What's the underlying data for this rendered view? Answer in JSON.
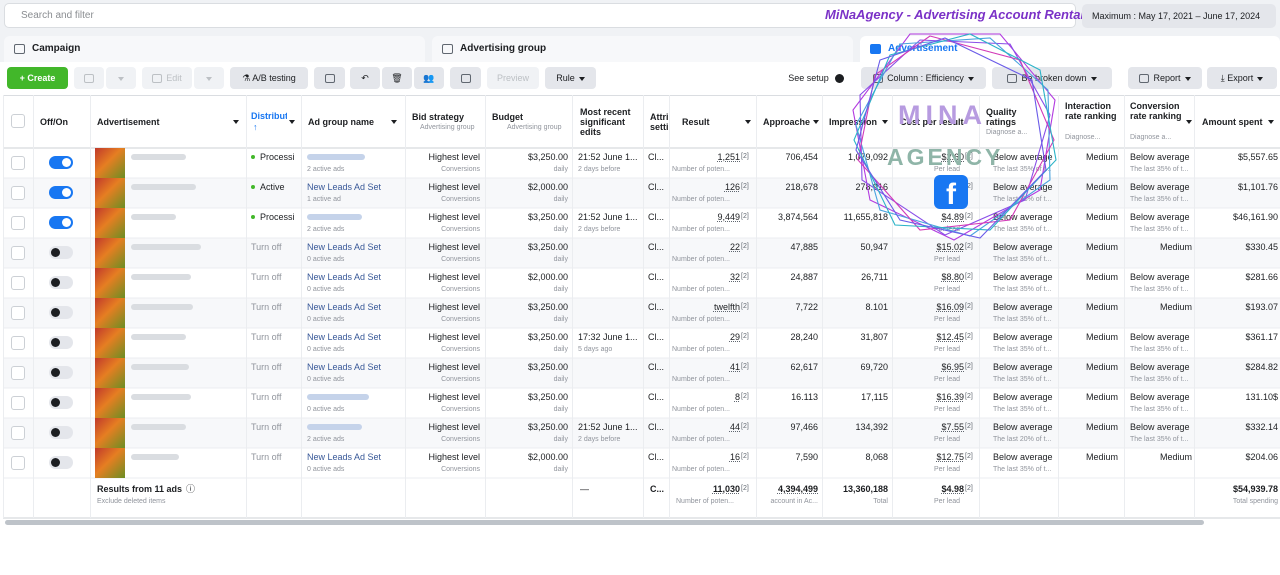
{
  "topbar": {
    "search_placeholder": "Search and filter",
    "brand": "MiNaAgency - Advertising Account Rental",
    "date_range": "Maximum : May 17, 2021 – June 17, 2024"
  },
  "tabs": [
    {
      "label": "Campaign",
      "icon": "folder-icon"
    },
    {
      "label": "Advertising group",
      "icon": "grid-icon"
    },
    {
      "label": "Advertisement",
      "icon": "ad-icon",
      "active": true
    }
  ],
  "toolbar": {
    "create": "Create",
    "edit": "Edit",
    "ab_testing": "A/B testing",
    "preview": "Preview",
    "rule": "Rule",
    "see_setup": "See setup",
    "column": "Column : Efficiency",
    "broken_down": "Be broken down",
    "report": "Report",
    "export": "Export"
  },
  "columns": {
    "off_on": "Off/On",
    "advertisement": "Advertisement",
    "distribution": "Distribution",
    "sort_arrow": "↑",
    "ad_group_name": "Ad group name",
    "bid_strategy": "Bid strategy",
    "bid_strategy_sub": "Advertising group",
    "budget": "Budget",
    "budget_sub": "Advertising group",
    "most_recent": "Most recent significant edits",
    "attribution": "Attribution settings",
    "result": "Result",
    "approach": "Approache",
    "impression": "Impression",
    "cost": "Cost per result",
    "quality": "Quality ratings",
    "quality_sub": "Diagnose a...",
    "interaction": "Interaction rate ranking",
    "interaction_sub": "Diagnose...",
    "conversion": "Conversion rate ranking",
    "conversion_sub": "Diagnose a...",
    "amount": "Amount spent"
  },
  "rows": [
    {
      "on": true,
      "status": "Processi",
      "status_dot": true,
      "group": "",
      "group_sub": "2 active ads",
      "bid": "Highest level",
      "bid_sub": "Conversions",
      "budget": "$3,250.00",
      "budget_sub": "daily",
      "edit": "21:52 June 1...",
      "edit_sub": "2 days before",
      "attr": "Cl...",
      "result": "1,251",
      "result_note": "[2]",
      "result_sub": "Number of poten...",
      "reach": "706,454",
      "impr": "1,079,092",
      "cost": "$2.60",
      "cost_note": "[2]",
      "cost_sub": "Per lead",
      "quality": "Below average",
      "quality_sub": "The last 35% of t...",
      "interaction": "Medium",
      "conversion": "Below average",
      "conversion_sub": "The last 35% of t...",
      "amount": "$5,557.65"
    },
    {
      "on": true,
      "status": "Active",
      "status_dot": true,
      "group": "New Leads Ad Set",
      "group_sub": "1 active ad",
      "bid": "Highest level",
      "bid_sub": "Conversions",
      "budget": "$2,000.00",
      "budget_sub": "daily",
      "edit": "",
      "edit_sub": "",
      "attr": "Cl...",
      "result": "126",
      "result_note": "[2]",
      "result_sub": "Number of poten...",
      "reach": "218,678",
      "impr": "278,916",
      "cost": "$8.74",
      "cost_note": "[2]",
      "cost_sub": "Per lead",
      "quality": "Below average",
      "quality_sub": "The last 35% of t...",
      "interaction": "Medium",
      "conversion": "Below average",
      "conversion_sub": "The last 35% of t...",
      "amount": "$1,101.76"
    },
    {
      "on": true,
      "status": "Processi",
      "status_dot": true,
      "group": "",
      "group_sub": "2 active ads",
      "bid": "Highest level",
      "bid_sub": "Conversions",
      "budget": "$3,250.00",
      "budget_sub": "daily",
      "edit": "21:52 June 1...",
      "edit_sub": "2 days before",
      "attr": "Cl...",
      "result": "9,449",
      "result_note": "[2]",
      "result_sub": "Number of poten...",
      "reach": "3,874,564",
      "impr": "11,655,818",
      "cost": "$4.89",
      "cost_note": "[2]",
      "cost_sub": "Per lead",
      "quality": "Below average",
      "quality_sub": "The last 35% of t...",
      "interaction": "Medium",
      "conversion": "Below average",
      "conversion_sub": "The last 35% of t...",
      "amount": "$46,161.90"
    },
    {
      "on": false,
      "status": "Turn off",
      "status_dot": false,
      "group": "New Leads Ad Set",
      "group_sub": "0 active ads",
      "bid": "Highest level",
      "bid_sub": "Conversions",
      "budget": "$3,250.00",
      "budget_sub": "daily",
      "edit": "",
      "edit_sub": "",
      "attr": "Cl...",
      "result": "22",
      "result_note": "[2]",
      "result_sub": "Number of poten...",
      "reach": "47,885",
      "impr": "50,947",
      "cost": "$15.02",
      "cost_note": "[2]",
      "cost_sub": "Per lead",
      "quality": "Below average",
      "quality_sub": "The last 35% of t...",
      "interaction": "Medium",
      "conversion": "Medium",
      "conversion_sub": "",
      "amount": "$330.45"
    },
    {
      "on": false,
      "status": "Turn off",
      "status_dot": false,
      "group": "New Leads Ad Set",
      "group_sub": "0 active ads",
      "bid": "Highest level",
      "bid_sub": "Conversions",
      "budget": "$2,000.00",
      "budget_sub": "daily",
      "edit": "",
      "edit_sub": "",
      "attr": "Cl...",
      "result": "32",
      "result_note": "[2]",
      "result_sub": "Number of poten...",
      "reach": "24,887",
      "impr": "26,711",
      "cost": "$8.80",
      "cost_note": "[2]",
      "cost_sub": "Per lead",
      "quality": "Below average",
      "quality_sub": "The last 35% of t...",
      "interaction": "Medium",
      "conversion": "Below average",
      "conversion_sub": "The last 35% of t...",
      "amount": "$281.66"
    },
    {
      "on": false,
      "status": "Turn off",
      "status_dot": false,
      "group": "New Leads Ad Set",
      "group_sub": "0 active ads",
      "bid": "Highest level",
      "bid_sub": "Conversions",
      "budget": "$3,250.00",
      "budget_sub": "daily",
      "edit": "",
      "edit_sub": "",
      "attr": "Cl...",
      "result": "twelfth",
      "result_note": "[2]",
      "result_sub": "Number of poten...",
      "reach": "7,722",
      "impr": "8.101",
      "cost": "$16.09",
      "cost_note": "[2]",
      "cost_sub": "Per lead",
      "quality": "Below average",
      "quality_sub": "The last 35% of t...",
      "interaction": "Medium",
      "conversion": "Medium",
      "conversion_sub": "",
      "amount": "$193.07"
    },
    {
      "on": false,
      "status": "Turn off",
      "status_dot": false,
      "group": "New Leads Ad Set",
      "group_sub": "0 active ads",
      "bid": "Highest level",
      "bid_sub": "Conversions",
      "budget": "$3,250.00",
      "budget_sub": "daily",
      "edit": "17:32 June 1...",
      "edit_sub": "5 days ago",
      "attr": "Cl...",
      "result": "29",
      "result_note": "[2]",
      "result_sub": "Number of poten...",
      "reach": "28,240",
      "impr": "31,807",
      "cost": "$12.45",
      "cost_note": "[2]",
      "cost_sub": "Per lead",
      "quality": "Below average",
      "quality_sub": "The last 35% of t...",
      "interaction": "Medium",
      "conversion": "Below average",
      "conversion_sub": "The last 35% of t...",
      "amount": "$361.17"
    },
    {
      "on": false,
      "status": "Turn off",
      "status_dot": false,
      "group": "New Leads Ad Set",
      "group_sub": "0 active ads",
      "bid": "Highest level",
      "bid_sub": "Conversions",
      "budget": "$3,250.00",
      "budget_sub": "daily",
      "edit": "",
      "edit_sub": "",
      "attr": "Cl...",
      "result": "41",
      "result_note": "[2]",
      "result_sub": "Number of poten...",
      "reach": "62,617",
      "impr": "69,720",
      "cost": "$6.95",
      "cost_note": "[2]",
      "cost_sub": "Per lead",
      "quality": "Below average",
      "quality_sub": "The last 35% of t...",
      "interaction": "Medium",
      "conversion": "Below average",
      "conversion_sub": "The last 35% of t...",
      "amount": "$284.82"
    },
    {
      "on": false,
      "status": "Turn off",
      "status_dot": false,
      "group": "",
      "group_sub": "0 active ads",
      "bid": "Highest level",
      "bid_sub": "Conversions",
      "budget": "$3,250.00",
      "budget_sub": "daily",
      "edit": "",
      "edit_sub": "",
      "attr": "Cl...",
      "result": "8",
      "result_note": "[2]",
      "result_sub": "Number of poten...",
      "reach": "16.113",
      "impr": "17,115",
      "cost": "$16.39",
      "cost_note": "[2]",
      "cost_sub": "Per lead",
      "quality": "Below average",
      "quality_sub": "The last 35% of t...",
      "interaction": "Medium",
      "conversion": "Below average",
      "conversion_sub": "The last 35% of t...",
      "amount": "131.10$"
    },
    {
      "on": false,
      "status": "Turn off",
      "status_dot": false,
      "group": "",
      "group_sub": "2 active ads",
      "bid": "Highest level",
      "bid_sub": "Conversions",
      "budget": "$3,250.00",
      "budget_sub": "daily",
      "edit": "21:52 June 1...",
      "edit_sub": "2 days before",
      "attr": "Cl...",
      "result": "44",
      "result_note": "[2]",
      "result_sub": "Number of poten...",
      "reach": "97,466",
      "impr": "134,392",
      "cost": "$7.55",
      "cost_note": "[2]",
      "cost_sub": "Per lead",
      "quality": "Below average",
      "quality_sub": "The last 20% of t...",
      "interaction": "Medium",
      "conversion": "Below average",
      "conversion_sub": "The last 35% of t...",
      "amount": "$332.14"
    },
    {
      "on": false,
      "status": "Turn off",
      "status_dot": false,
      "group": "New Leads Ad Set",
      "group_sub": "0 active ads",
      "bid": "Highest level",
      "bid_sub": "Conversions",
      "budget": "$2,000.00",
      "budget_sub": "daily",
      "edit": "",
      "edit_sub": "",
      "attr": "Cl...",
      "result": "16",
      "result_note": "[2]",
      "result_sub": "Number of poten...",
      "reach": "7,590",
      "impr": "8,068",
      "cost": "$12.75",
      "cost_note": "[2]",
      "cost_sub": "Per lead",
      "quality": "Below average",
      "quality_sub": "The last 35% of t...",
      "interaction": "Medium",
      "conversion": "Medium",
      "conversion_sub": "",
      "amount": "$204.06"
    }
  ],
  "totals": {
    "label": "Results from 11 ads",
    "sub": "Exclude deleted items",
    "edit": "—",
    "attr": "C...",
    "result": "11,030",
    "result_note": "[2]",
    "result_sub": "Number of poten...",
    "reach": "4,394,499",
    "reach_sub": "account in Ac...",
    "impr": "13,360,188",
    "impr_sub": "Total",
    "cost": "$4.98",
    "cost_note": "[2]",
    "cost_sub": "Per lead",
    "amount": "$54,939.78",
    "amount_sub": "Total spending"
  },
  "watermark": {
    "line1": "MINA",
    "line2": "AGENCY",
    "fb": "f"
  },
  "colors": {
    "accent": "#1877f2",
    "create": "#42b72a",
    "brand": "#7b32c7",
    "link": "#385898"
  }
}
